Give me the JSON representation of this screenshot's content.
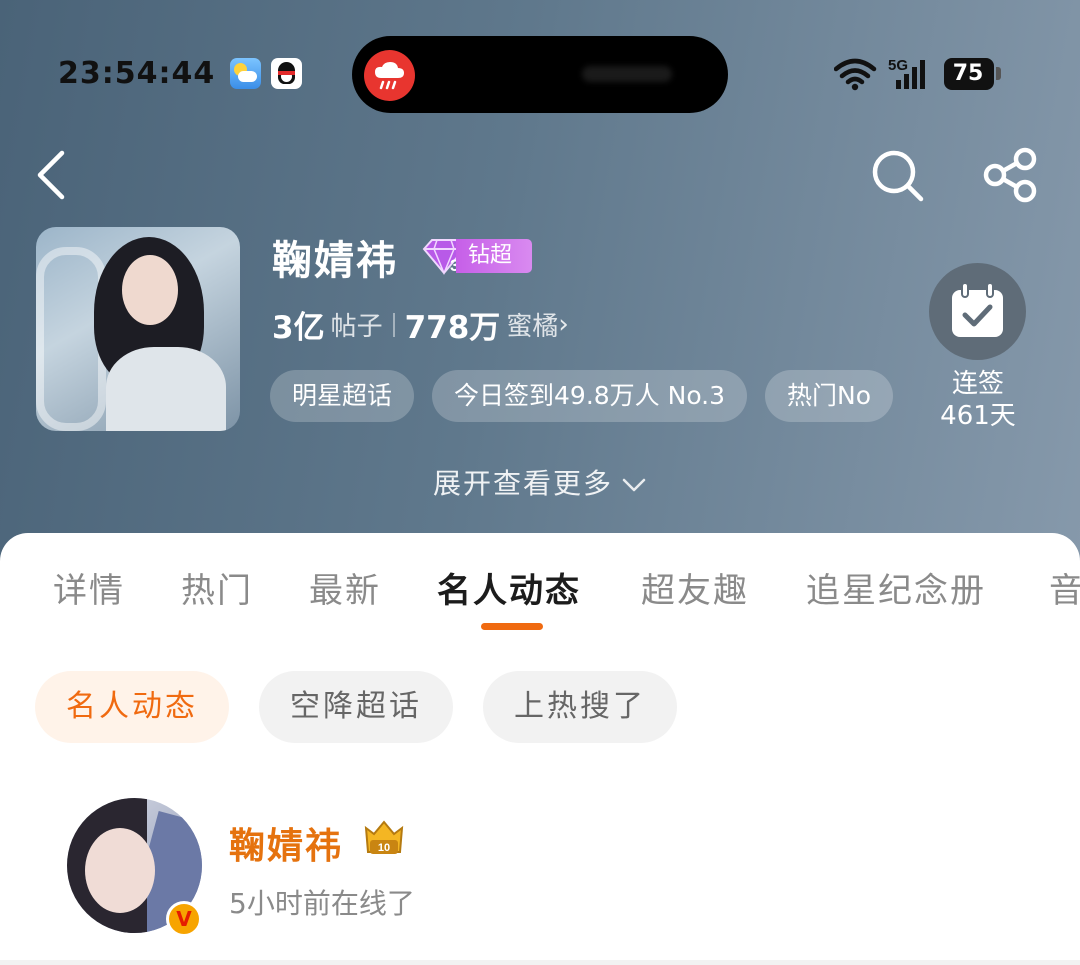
{
  "status_bar": {
    "time": "23:54:44",
    "network": "5G",
    "battery": "75",
    "apps": [
      "weather-app-icon",
      "qq-app-icon"
    ]
  },
  "nav": {
    "icons": [
      "back-arrow-icon",
      "search-icon",
      "share-icon"
    ]
  },
  "profile": {
    "name": "鞠婧祎",
    "badge_level": "3",
    "badge_label": "钻超",
    "posts_count": "3亿",
    "posts_label": "帖子",
    "followers_count": "778万",
    "followers_label": "蜜橘",
    "chips": [
      "明星超话",
      "今日签到49.8万人 No.3",
      "热门No"
    ],
    "checkin_label_line1": "连签",
    "checkin_label_line2": "461天",
    "expand_label": "展开查看更多"
  },
  "tabs": [
    {
      "label": "详情",
      "active": false
    },
    {
      "label": "热门",
      "active": false
    },
    {
      "label": "最新",
      "active": false
    },
    {
      "label": "名人动态",
      "active": true
    },
    {
      "label": "超友趣",
      "active": false
    },
    {
      "label": "追星纪念册",
      "active": false
    },
    {
      "label": "音",
      "active": false
    }
  ],
  "filters": [
    {
      "label": "名人动态",
      "active": true
    },
    {
      "label": "空降超话",
      "active": false
    },
    {
      "label": "上热搜了",
      "active": false
    }
  ],
  "feed": {
    "user_name": "鞠婧祎",
    "level_badge": "10",
    "status": "5小时前在线了"
  },
  "colors": {
    "accent": "#f06a10",
    "username": "#e5720e",
    "badge_purple": "#c65fe8"
  }
}
